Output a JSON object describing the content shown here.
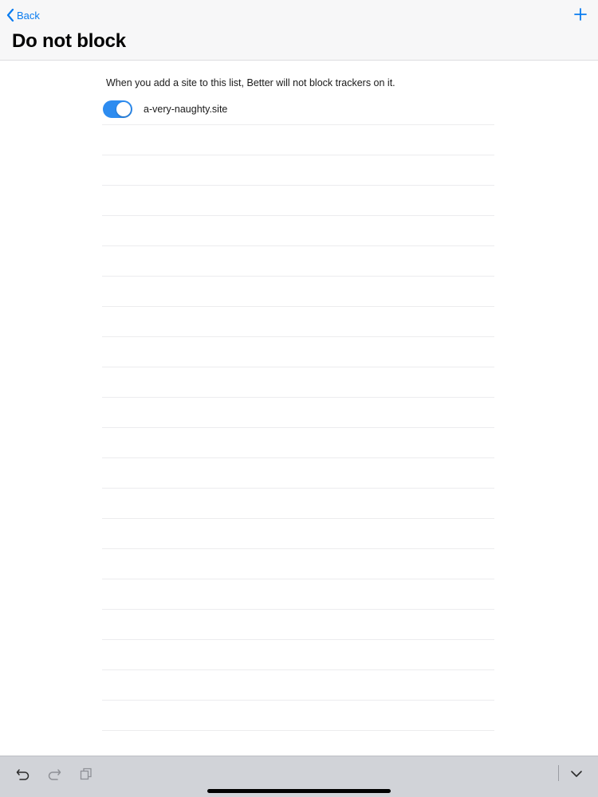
{
  "nav": {
    "back_label": "Back",
    "title": "Do not block",
    "back_icon": "chevron-left-icon",
    "add_icon": "plus-icon"
  },
  "content": {
    "description": "When you add a site to this list, Better will not block trackers on it.",
    "sites": [
      {
        "name": "a-very-naughty.site",
        "enabled": true
      }
    ]
  },
  "toolbar": {
    "icons": [
      "undo-icon",
      "redo-icon",
      "paste-icon",
      "chevron-down-icon"
    ]
  },
  "colors": {
    "accent": "#0a7cf0",
    "toggle_on": "#2d8cf0",
    "navbar_bg": "#f7f7f8",
    "toolbar_bg": "#d1d3d8"
  }
}
